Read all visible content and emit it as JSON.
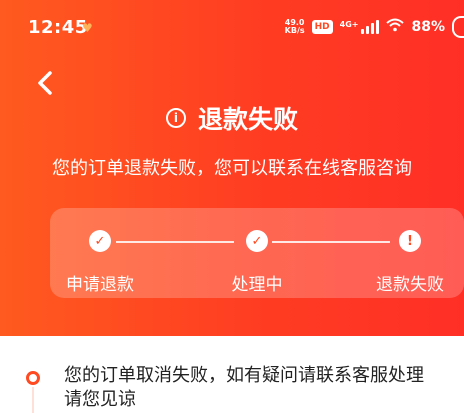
{
  "status": {
    "time": "12:45",
    "speed_top": "49.0",
    "speed_bottom": "KB/s",
    "hd_badge": "HD",
    "network": "4G+",
    "battery": "88%"
  },
  "header": {
    "back_icon": "chevron-left-icon",
    "info_icon": "info-circle-icon",
    "title": "退款失败",
    "subtitle": "您的订单退款失败，您可以联系在线客服咨询"
  },
  "progress": {
    "steps": [
      {
        "label": "申请退款",
        "icon": "check-icon"
      },
      {
        "label": "处理中",
        "icon": "check-icon"
      },
      {
        "label": "退款失败",
        "icon": "alert-icon"
      }
    ]
  },
  "detail": {
    "line1": "您的订单取消失败，如有疑问请联系客服处理",
    "line2": "请您见谅"
  },
  "colors": {
    "accent": "#ff4a22",
    "gradient_start": "#ff5a1f",
    "gradient_end": "#ff2f26"
  }
}
